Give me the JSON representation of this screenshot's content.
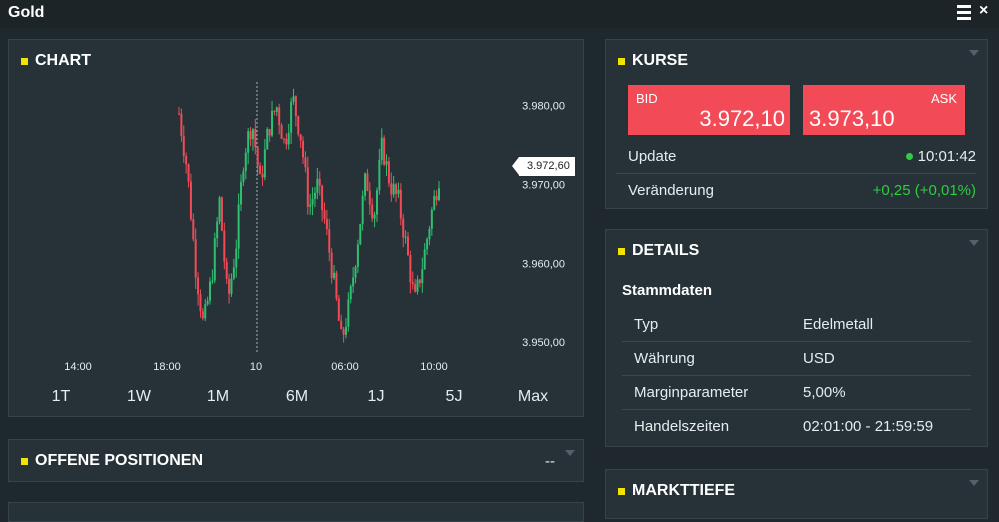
{
  "window": {
    "title": "Gold"
  },
  "chart": {
    "title": "CHART",
    "current_price_tag": "3.972,60",
    "ranges": [
      "1T",
      "1W",
      "1M",
      "6M",
      "1J",
      "5J",
      "Max"
    ],
    "active_range": "1T"
  },
  "chart_data": {
    "type": "candlestick",
    "x_ticks": [
      "14:00",
      "18:00",
      "10",
      "06:00",
      "10:00"
    ],
    "y_ticks": [
      "3.980,00",
      "3.970,00",
      "3.960,00",
      "3.950,00"
    ],
    "ylim": [
      3948,
      3983
    ],
    "colors": {
      "up": "#2fbf71",
      "down": "#f24b57"
    },
    "close": [
      3979,
      3972,
      3960,
      3952,
      3958,
      3968,
      3955,
      3962,
      3974,
      3978,
      3970,
      3977,
      3980,
      3975,
      3981,
      3976,
      3967,
      3970,
      3965,
      3958,
      3950,
      3955,
      3963,
      3971,
      3966,
      3975,
      3970,
      3968,
      3962,
      3955,
      3960,
      3966,
      3971
    ]
  },
  "offene_positionen": {
    "title": "OFFENE POSITIONEN",
    "value": "--"
  },
  "kurse": {
    "title": "KURSE",
    "bid_label": "BID",
    "bid_value": "3.972,10",
    "ask_label": "ASK",
    "ask_value": "3.973,10",
    "update_label": "Update",
    "update_value": "10:01:42",
    "change_label": "Veränderung",
    "change_value": "+0,25 (+0,01%)"
  },
  "details": {
    "title": "DETAILS",
    "section": "Stammdaten",
    "rows": [
      {
        "label": "Typ",
        "value": "Edelmetall"
      },
      {
        "label": "Währung",
        "value": "USD"
      },
      {
        "label": "Marginparameter",
        "value": "5,00%"
      },
      {
        "label": "Handelszeiten",
        "value": "02:01:00 - 21:59:59"
      }
    ]
  },
  "markttiefe": {
    "title": "MARKTTIEFE"
  },
  "colors": {
    "accent": "#f2e400",
    "quote_bg": "#f24b57",
    "positive": "#2ecc40"
  }
}
